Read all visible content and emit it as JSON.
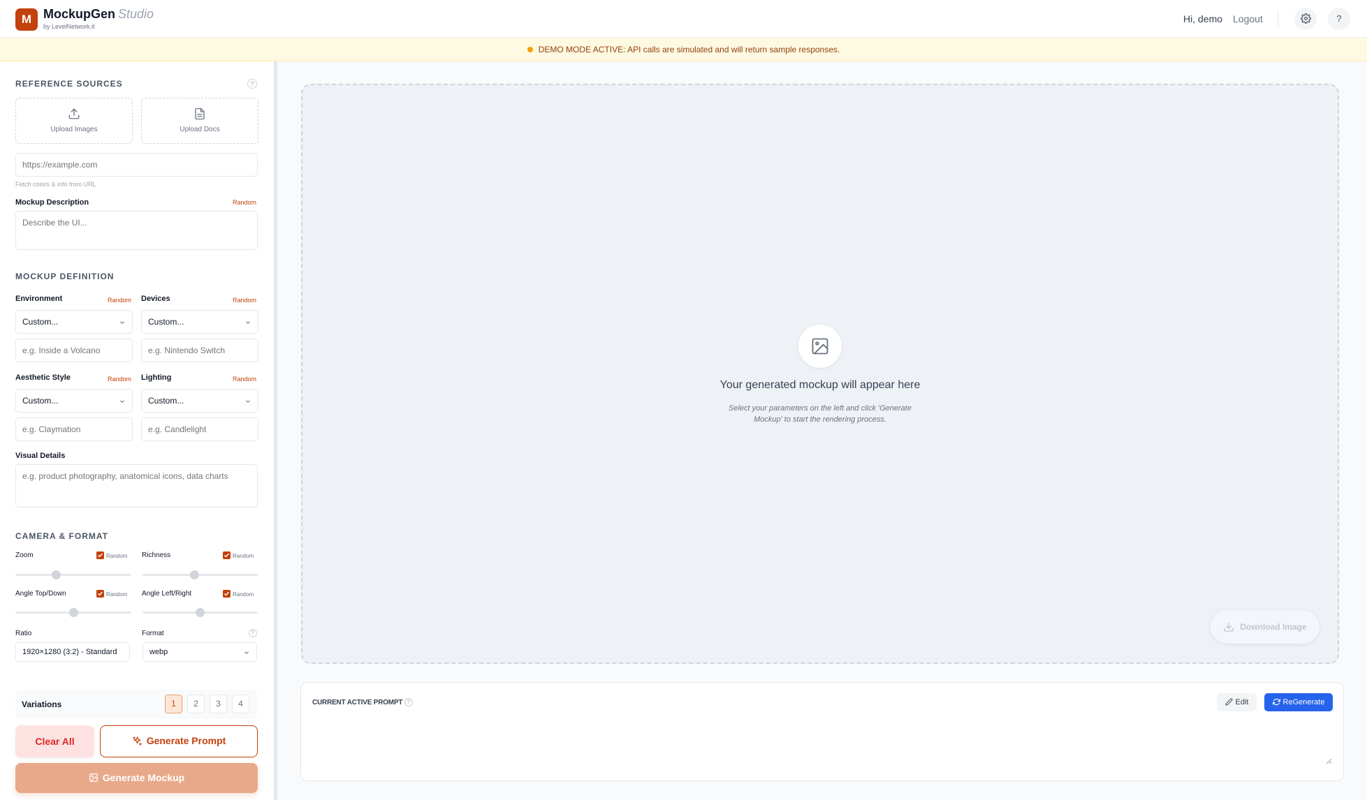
{
  "header": {
    "logo_letter": "M",
    "app_name": "MockupGen",
    "app_suffix": "Studio",
    "byline": "by LevelNetwork.it",
    "greeting": "Hi, demo",
    "logout_label": "Logout",
    "help_label": "?"
  },
  "banner": {
    "text": "DEMO MODE ACTIVE: API calls are simulated and will return sample responses."
  },
  "reference_sources": {
    "title": "REFERENCE SOURCES",
    "upload_images_label": "Upload Images",
    "upload_docs_label": "Upload Docs",
    "url_placeholder": "https://example.com",
    "url_hint": "Fetch colors & info from URL",
    "description_label": "Mockup Description",
    "description_random": "Random",
    "description_placeholder": "Describe the UI..."
  },
  "mockup_definition": {
    "title": "MOCKUP DEFINITION",
    "environment": {
      "label": "Environment",
      "random": "Random",
      "selected": "Custom...",
      "placeholder": "e.g. Inside a Volcano"
    },
    "devices": {
      "label": "Devices",
      "random": "Random",
      "selected": "Custom...",
      "placeholder": "e.g. Nintendo Switch"
    },
    "aesthetic": {
      "label": "Aesthetic Style",
      "random": "Random",
      "selected": "Custom...",
      "placeholder": "e.g. Claymation"
    },
    "lighting": {
      "label": "Lighting",
      "random": "Random",
      "selected": "Custom...",
      "placeholder": "e.g. Candlelight"
    },
    "visual_details": {
      "label": "Visual Details",
      "placeholder": "e.g. product photography, anatomical icons, data charts"
    }
  },
  "camera_format": {
    "title": "CAMERA & FORMAT",
    "zoom": {
      "label": "Zoom",
      "random_label": "Random",
      "random_checked": true,
      "value_fraction": 0.35
    },
    "richness": {
      "label": "Richness",
      "random_label": "Random",
      "random_checked": true,
      "value_fraction": 0.45
    },
    "angle_top_down": {
      "label": "Angle Top/Down",
      "random_label": "Random",
      "random_checked": true,
      "value_fraction": 0.5
    },
    "angle_left_right": {
      "label": "Angle Left/Right",
      "random_label": "Random",
      "random_checked": true,
      "value_fraction": 0.5
    },
    "ratio": {
      "label": "Ratio",
      "selected": "1920×1280 (3:2) - Standard"
    },
    "format": {
      "label": "Format",
      "selected": "webp"
    }
  },
  "variations": {
    "label": "Variations",
    "options": [
      "1",
      "2",
      "3",
      "4"
    ],
    "selected": "1"
  },
  "actions": {
    "clear_all": "Clear All",
    "generate_prompt": "Generate Prompt",
    "generate_mockup": "Generate Mockup"
  },
  "preview": {
    "title": "Your generated mockup will appear here",
    "description_line1": "Select your parameters on the left and click 'Generate",
    "description_line2": "Mockup' to start the rendering process.",
    "download_label": "Download Image"
  },
  "prompt_panel": {
    "title": "CURRENT ACTIVE PROMPT",
    "edit_label": "Edit",
    "regenerate_label": "ReGenerate"
  },
  "colors": {
    "brand": "#c2410c",
    "accent_blue": "#2563eb",
    "banner_bg": "#fef9e1",
    "danger": "#dc2626"
  }
}
